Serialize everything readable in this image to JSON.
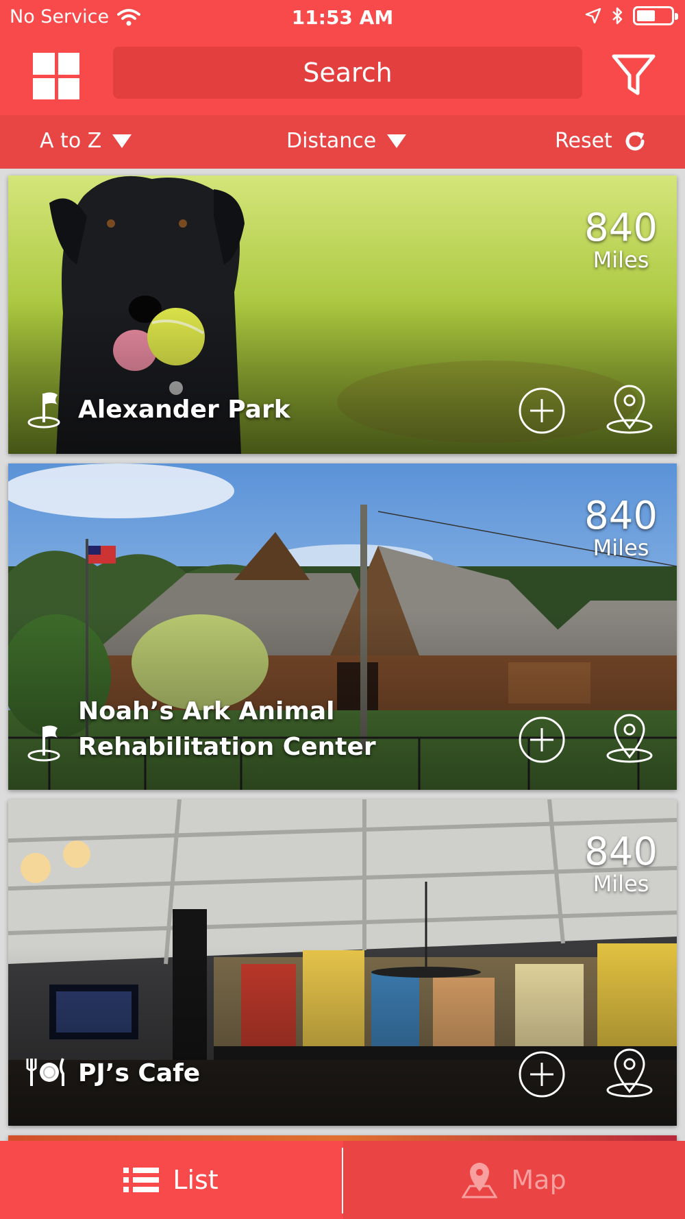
{
  "status_bar": {
    "carrier": "No Service",
    "time": "11:53 AM"
  },
  "header": {
    "search_placeholder": "Search"
  },
  "sort_bar": {
    "sort_az": "A to Z",
    "sort_distance": "Distance",
    "reset": "Reset"
  },
  "cards": [
    {
      "title": "Alexander Park",
      "distance": "840",
      "unit": "Miles",
      "category_icon": "flag-icon"
    },
    {
      "title_line1": "Noah’s Ark Animal",
      "title_line2": "Rehabilitation Center",
      "distance": "840",
      "unit": "Miles",
      "category_icon": "flag-icon"
    },
    {
      "title": "PJ’s Cafe",
      "distance": "840",
      "unit": "Miles",
      "category_icon": "dining-icon"
    }
  ],
  "tabs": {
    "list": "List",
    "map": "Map"
  },
  "colors": {
    "brand_red": "#f84a4a",
    "sort_bar_red": "#e84545",
    "search_field": "#e33f3f",
    "inactive_tab_text": "#f8a0a0"
  }
}
